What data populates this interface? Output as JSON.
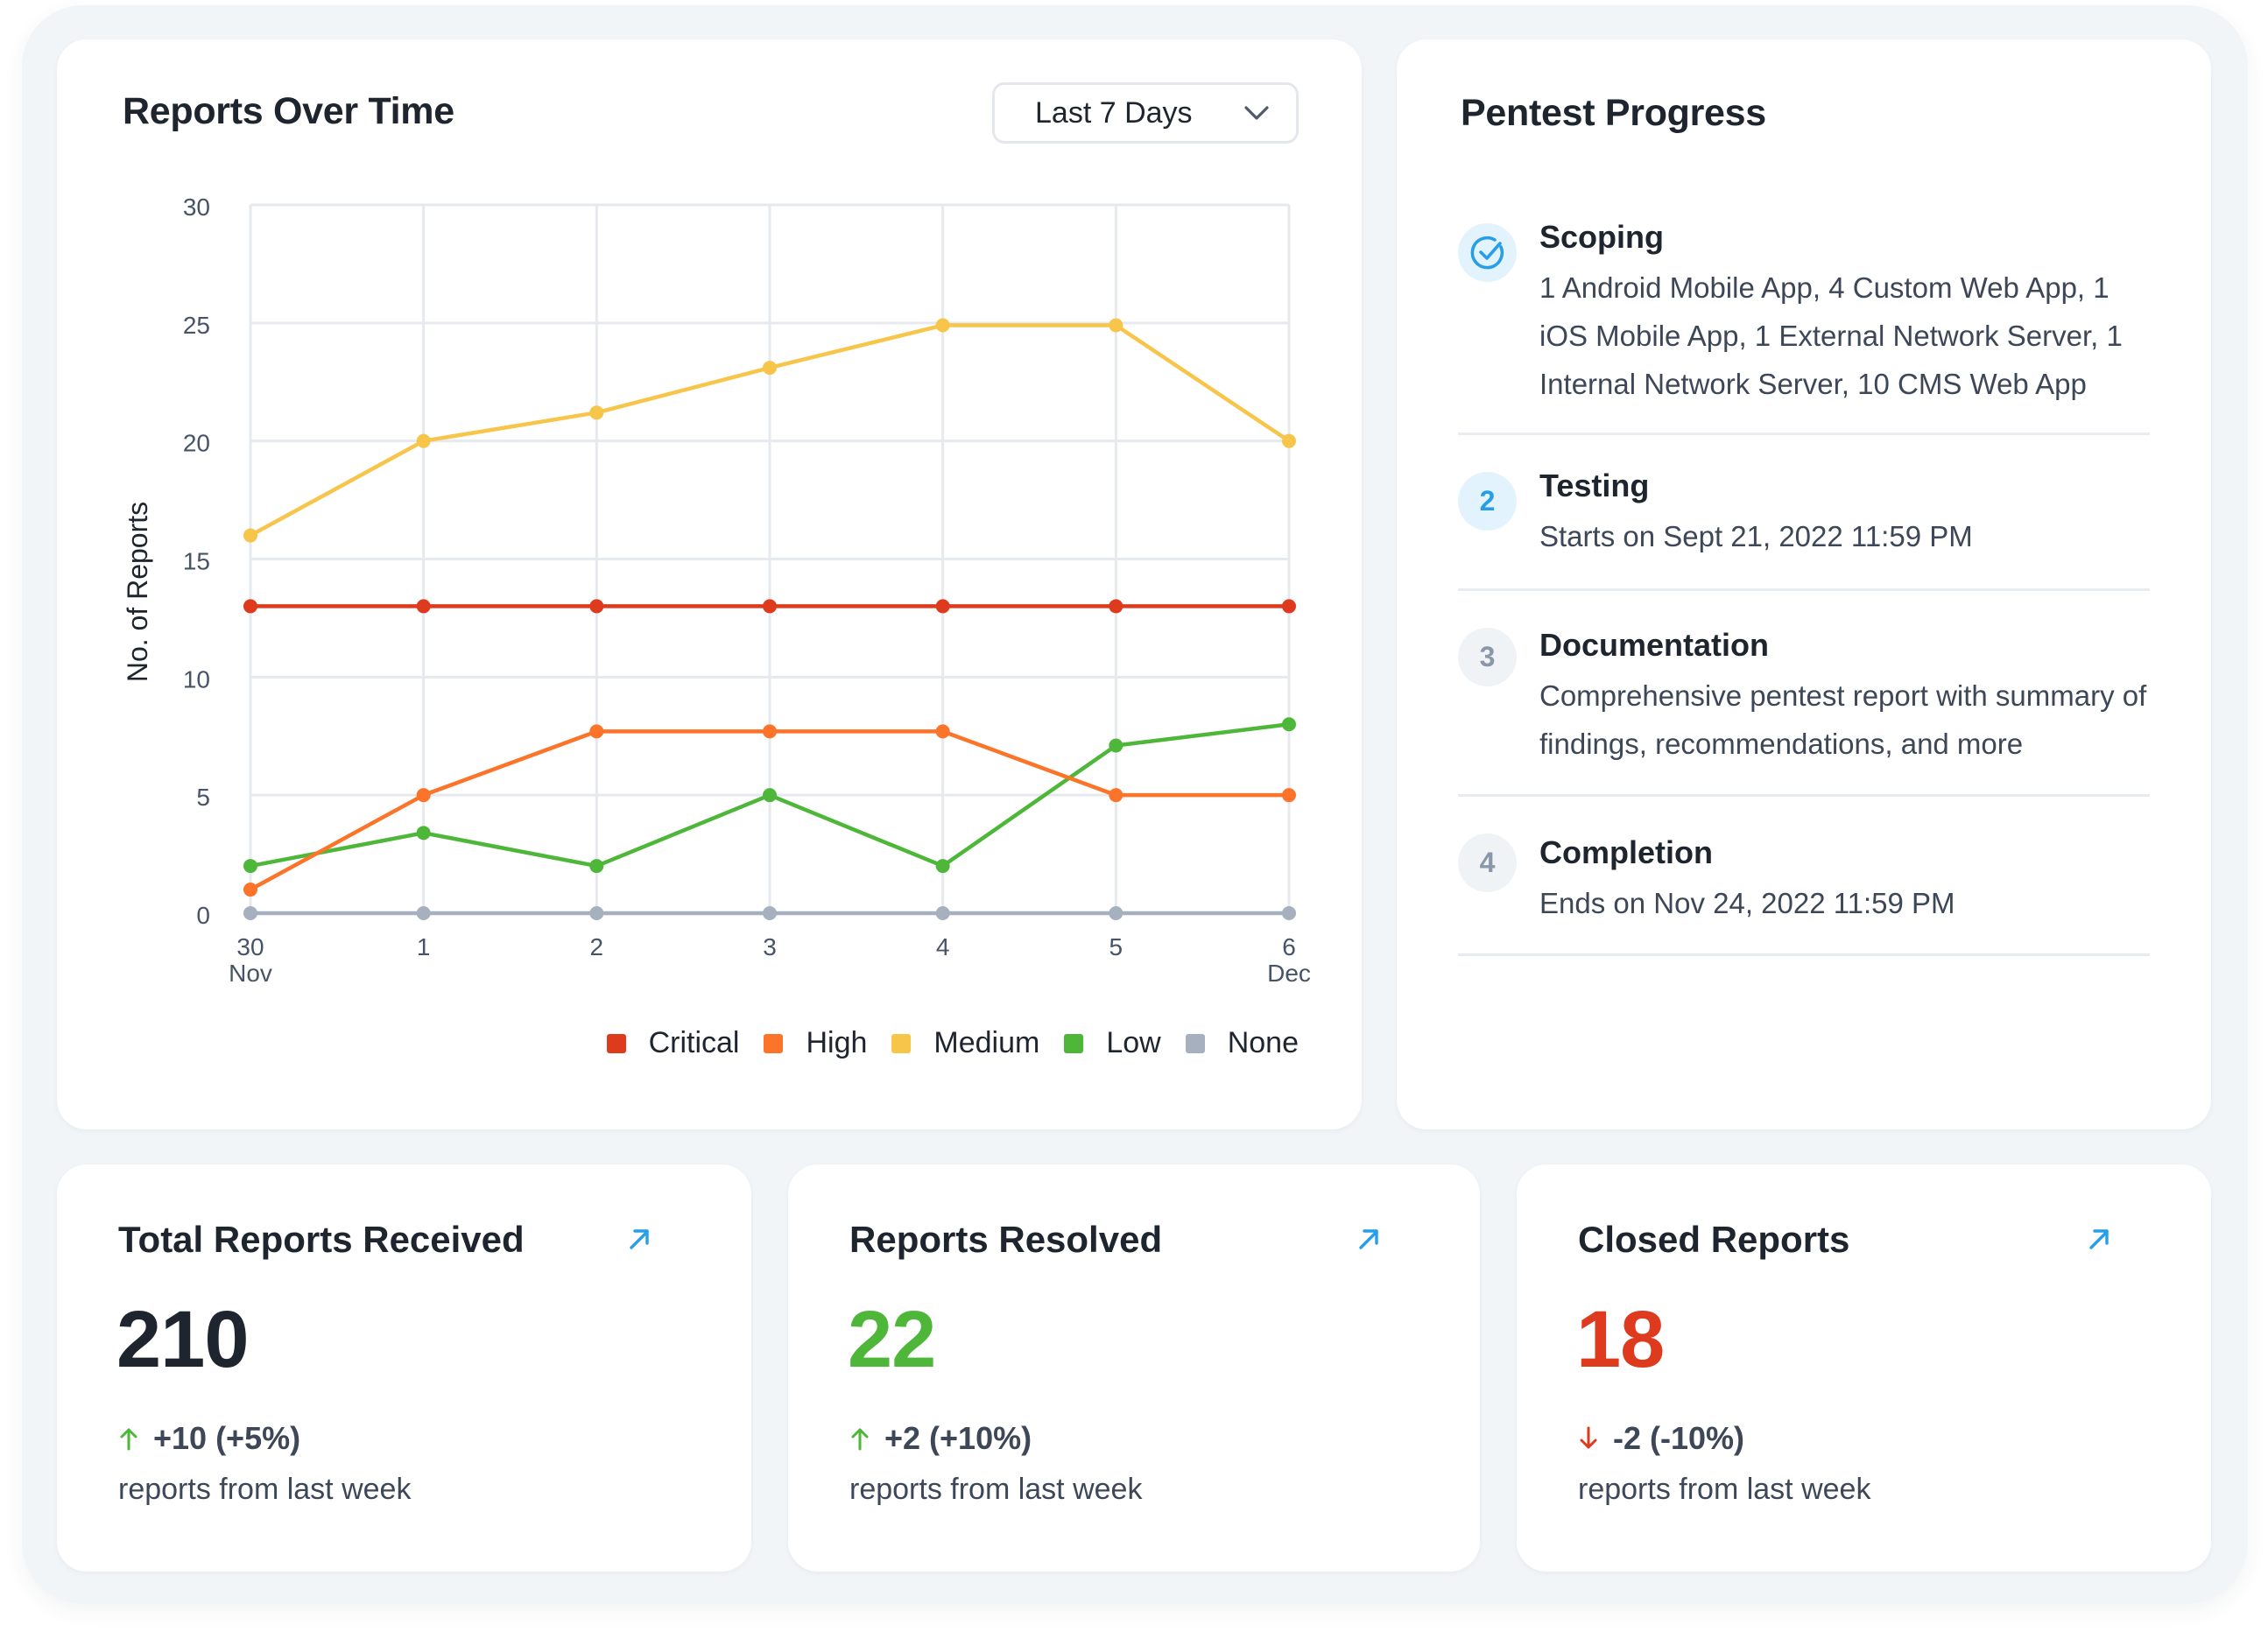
{
  "colors": {
    "critical": "#dd3a1e",
    "high": "#fb7429",
    "medium": "#f6c54a",
    "low": "#4eb73a",
    "none": "#a6b0be",
    "accent": "#279fe6",
    "positive": "#4eb73a",
    "negative": "#dd3a1e",
    "text_primary": "#1e252e"
  },
  "reports_over_time": {
    "title": "Reports Over Time",
    "range_dropdown": {
      "selected": "Last 7 Days"
    }
  },
  "chart_data": {
    "type": "line",
    "title": "Reports Over Time",
    "xlabel": "",
    "ylabel": "No. of Reports",
    "x": [
      "30 Nov",
      "1",
      "2",
      "3",
      "4",
      "5",
      "6 Dec"
    ],
    "x_tick_labels": [
      {
        "top": "30",
        "bottom": "Nov"
      },
      {
        "top": "1",
        "bottom": ""
      },
      {
        "top": "2",
        "bottom": ""
      },
      {
        "top": "3",
        "bottom": ""
      },
      {
        "top": "4",
        "bottom": ""
      },
      {
        "top": "5",
        "bottom": ""
      },
      {
        "top": "6",
        "bottom": "Dec"
      }
    ],
    "y_ticks": [
      0,
      5,
      10,
      15,
      20,
      25,
      30
    ],
    "ylim": [
      0,
      30
    ],
    "grid": true,
    "legend_position": "bottom-right",
    "series": [
      {
        "name": "Critical",
        "color": "#dd3a1e",
        "values": [
          13,
          13,
          13,
          13,
          13,
          13,
          13
        ]
      },
      {
        "name": "High",
        "color": "#fb7429",
        "values": [
          1,
          5,
          7.7,
          7.7,
          7.7,
          5,
          5
        ]
      },
      {
        "name": "Medium",
        "color": "#f6c54a",
        "values": [
          16,
          20,
          21.2,
          23.1,
          24.9,
          24.9,
          20
        ]
      },
      {
        "name": "Low",
        "color": "#4eb73a",
        "values": [
          2,
          3.4,
          2,
          5,
          2,
          7.1,
          8
        ]
      },
      {
        "name": "None",
        "color": "#a6b0be",
        "values": [
          0,
          0,
          0,
          0,
          0,
          0,
          0
        ]
      }
    ]
  },
  "pentest_progress": {
    "title": "Pentest Progress",
    "steps": [
      {
        "marker": "",
        "status": "done",
        "title": "Scoping",
        "description": "1 Android Mobile App, 4 Custom Web App, 1 iOS Mobile App, 1 External Network Server, 1 Internal Network Server, 10 CMS Web App"
      },
      {
        "marker": "2",
        "status": "active",
        "title": "Testing",
        "description": "Starts on Sept 21, 2022 11:59 PM"
      },
      {
        "marker": "3",
        "status": "pending",
        "title": "Documentation",
        "description": "Comprehensive pentest report with summary of findings, recommendations, and more"
      },
      {
        "marker": "4",
        "status": "pending",
        "title": "Completion",
        "description": "Ends on Nov 24, 2022 11:59 PM"
      }
    ]
  },
  "stats": [
    {
      "title": "Total Reports Received",
      "value": "210",
      "value_color": "#1e252e",
      "trend": "up",
      "delta": "+10 (+5%)",
      "note": "reports from last week"
    },
    {
      "title": "Reports Resolved",
      "value": "22",
      "value_color": "#4eb73a",
      "trend": "up",
      "delta": "+2 (+10%)",
      "note": "reports from last week"
    },
    {
      "title": "Closed Reports",
      "value": "18",
      "value_color": "#dd3a1e",
      "trend": "down",
      "delta": "-2 (-10%)",
      "note": "reports from last week"
    }
  ]
}
